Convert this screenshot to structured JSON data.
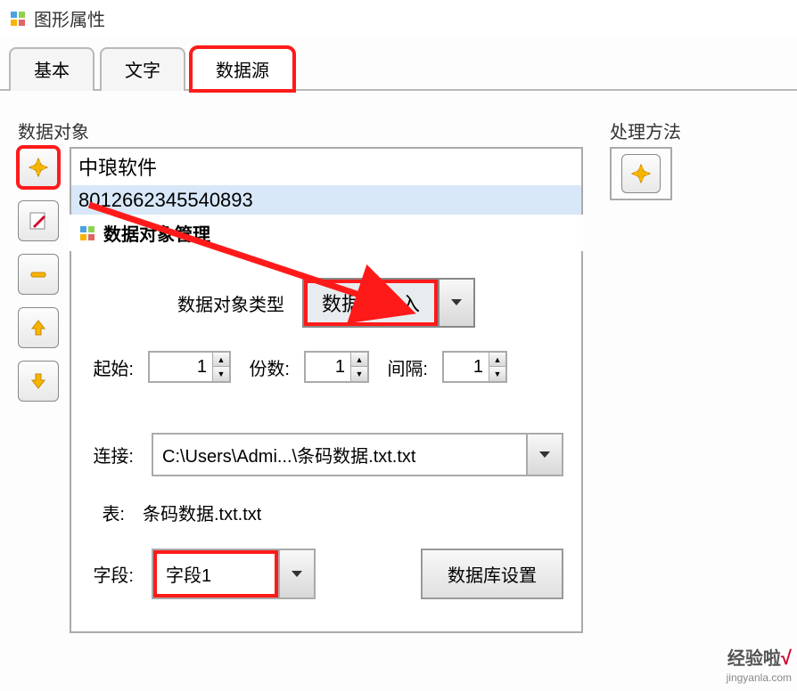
{
  "window": {
    "title": "图形属性"
  },
  "tabs": {
    "basic": "基本",
    "text": "文字",
    "datasource": "数据源"
  },
  "dataObject": {
    "label": "数据对象",
    "items": [
      "中琅软件",
      "8012662345540893"
    ]
  },
  "processMethod": {
    "label": "处理方法"
  },
  "subdialog": {
    "title": "数据对象管理",
    "typeLabel": "数据对象类型",
    "typeValue": "数据库导入",
    "startLabel": "起始:",
    "startValue": "1",
    "countLabel": "份数:",
    "countValue": "1",
    "intervalLabel": "间隔:",
    "intervalValue": "1",
    "connLabel": "连接:",
    "connValue": "C:\\Users\\Admi...\\条码数据.txt.txt",
    "tableLabel": "表:",
    "tableValue": "条码数据.txt.txt",
    "fieldLabel": "字段:",
    "fieldValue": "字段1",
    "dbSettingsBtn": "数据库设置"
  },
  "watermark": {
    "brand": "经验啦",
    "url": "jingyanla.com"
  }
}
